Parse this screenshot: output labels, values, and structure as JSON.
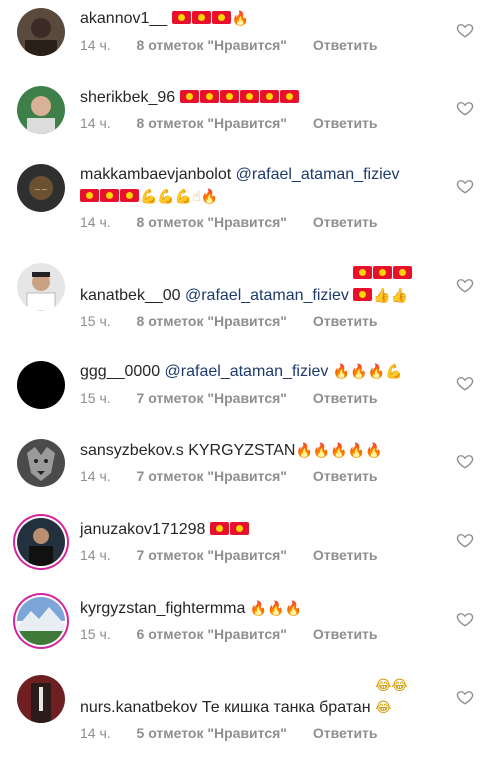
{
  "comments": [
    {
      "username": "akannov1__",
      "mention": "",
      "text": "",
      "emojis": "🇰🇬🇰🇬🇰🇬🔥",
      "time": "14 ч.",
      "likes": "8 отметок \"Нравится\"",
      "reply": "Ответить"
    },
    {
      "username": "sherikbek_96",
      "mention": "",
      "text": "",
      "emojis": "🇰🇬🇰🇬🇰🇬🇰🇬🇰🇬🇰🇬",
      "time": "14 ч.",
      "likes": "8 отметок \"Нравится\"",
      "reply": "Ответить"
    },
    {
      "username": "makkambaevjanbolot",
      "mention": "@rafael_ataman_fiziev",
      "text": "",
      "emojis": "🇰🇬🇰🇬🇰🇬💪💪💪☝🔥",
      "time": "14 ч.",
      "likes": "8 отметок \"Нравится\"",
      "reply": "Ответить"
    },
    {
      "username": "kanatbek__00",
      "mention": "@rafael_ataman_fiziev",
      "text": "",
      "emojis": "🇰🇬🇰🇬🇰🇬🇰🇬👍👍",
      "time": "15 ч.",
      "likes": "8 отметок \"Нравится\"",
      "reply": "Ответить"
    },
    {
      "username": "ggg__0000",
      "mention": "@rafael_ataman_fiziev",
      "text": "",
      "emojis": "🔥🔥🔥💪",
      "time": "15 ч.",
      "likes": "7 отметок \"Нравится\"",
      "reply": "Ответить"
    },
    {
      "username": "sansyzbekov.s",
      "mention": "",
      "text": "KYRGYZSTAN",
      "emojis": "🔥🔥🔥🔥🔥",
      "time": "14 ч.",
      "likes": "7 отметок \"Нравится\"",
      "reply": "Ответить"
    },
    {
      "username": "januzakov171298",
      "mention": "",
      "text": "",
      "emojis": "🇰🇬🇰🇬",
      "time": "14 ч.",
      "likes": "7 отметок \"Нравится\"",
      "reply": "Ответить"
    },
    {
      "username": "kyrgyzstan_fightermma",
      "mention": "",
      "text": "",
      "emojis": "🔥🔥🔥",
      "time": "15 ч.",
      "likes": "6 отметок \"Нравится\"",
      "reply": "Ответить"
    },
    {
      "username": "nurs.kanatbekov",
      "mention": "",
      "text": "Те кишка танка братан",
      "emojis": "😂😂😂",
      "time": "14 ч.",
      "likes": "5 отметок \"Нравится\"",
      "reply": "Ответить"
    }
  ],
  "icons": {
    "heart": "heart-outline-icon",
    "flag": "kyrgyzstan-flag-emoji",
    "fire": "fire-emoji",
    "muscle": "flexed-biceps-emoji",
    "thumb": "thumbs-up-emoji",
    "point": "index-pointing-up-emoji",
    "laugh": "tears-of-joy-emoji"
  },
  "colors": {
    "text": "#262626",
    "meta": "#8e8e8e",
    "mention": "#1e3a6e",
    "story_ring": "#d6249f"
  }
}
